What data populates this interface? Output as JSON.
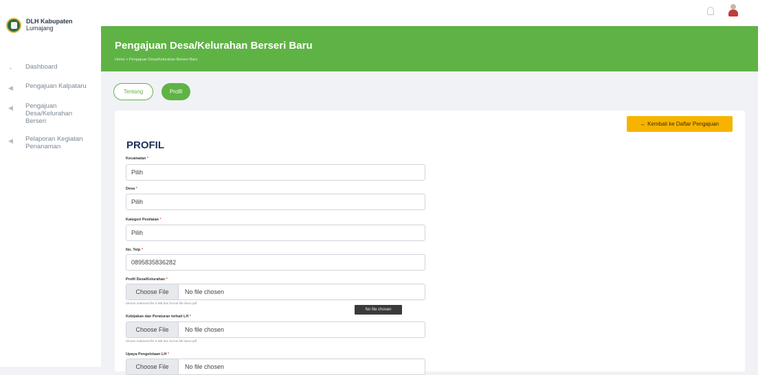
{
  "brand": {
    "name": "DLH Kabupaten",
    "sub": "Lumajang"
  },
  "sidebar": {
    "items": [
      {
        "label": "Dashboard",
        "icon": "gauge-icon"
      },
      {
        "label": "Pengajuan Kalpataru",
        "icon": "send-icon"
      },
      {
        "label": "Pengajuan Desa/Kelurahan Berseri",
        "icon": "send-icon"
      },
      {
        "label": "Pelaporan Kegiatan Penanaman",
        "icon": "send-icon"
      }
    ]
  },
  "header": {
    "title": "Pengajuan Desa/Kelurahan Berseri Baru",
    "breadcrumb": "Home  >  Pengajuan Desa/Kelurahan Berseri Baru"
  },
  "tabs": [
    {
      "label": "Tentang",
      "active": false
    },
    {
      "label": "Profil",
      "active": true
    }
  ],
  "back_button": "← Kembali ke Daftar Pengajuan",
  "section_title": "PROFIL",
  "form": {
    "kecamatan": {
      "label": "Kecamatan",
      "value": "Pilih"
    },
    "desa": {
      "label": "Desa",
      "value": "Pilih"
    },
    "kategori": {
      "label": "Kategori Penilaian",
      "value": "Pilih"
    },
    "telp": {
      "label": "No. Telp",
      "value": "0895835836282"
    },
    "profil_file": {
      "label": "Profil Desa/Kelurahan",
      "button": "Choose File",
      "status": "No file chosen",
      "hint": "Ukuran maksimal file 5 MB dan format file harus pdf"
    },
    "kebijakan_file": {
      "label": "Kebijakan dan Peraturan terkait LH",
      "button": "Choose File",
      "status": "No file chosen",
      "hint": "Ukuran maksimal file 5 MB dan format file harus pdf"
    },
    "upaya_file": {
      "label": "Upaya Pengelolaan LH",
      "button": "Choose File",
      "status": "No file chosen"
    }
  },
  "tooltip": "No file chosen",
  "colors": {
    "primary": "#5fb345",
    "accent": "#f6b400",
    "title": "#20305a"
  }
}
